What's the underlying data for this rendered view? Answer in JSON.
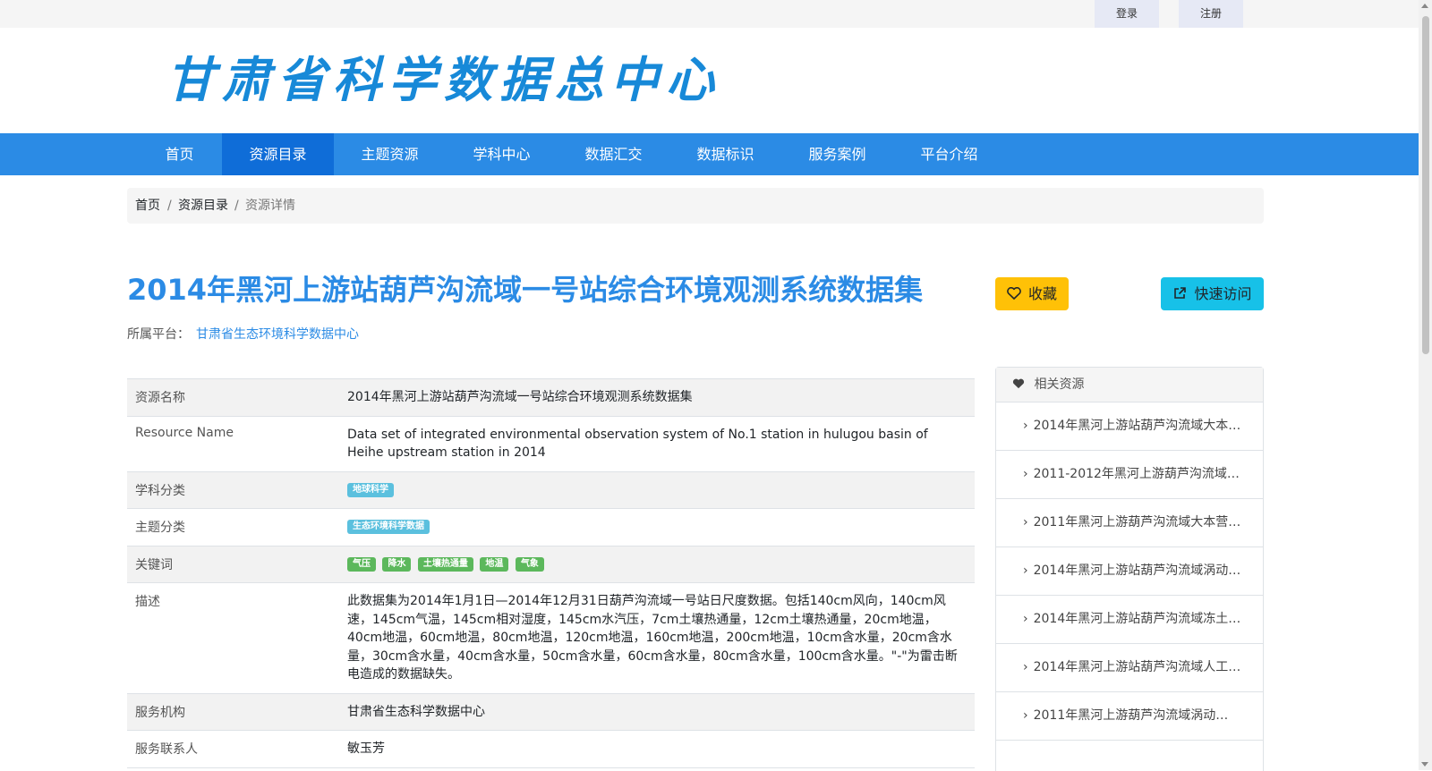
{
  "topbar": {
    "login": "登录",
    "register": "注册"
  },
  "logo": {
    "text": "甘肃省科学数据总中心"
  },
  "nav": [
    "首页",
    "资源目录",
    "主题资源",
    "学科中心",
    "数据汇交",
    "数据标识",
    "服务案例",
    "平台介绍"
  ],
  "nav_active": "资源目录",
  "breadcrumb": {
    "home": "首页",
    "sep1": "/",
    "catalog": "资源目录",
    "sep2": "/",
    "current": "资源详情"
  },
  "title": "2014年黑河上游站葫芦沟流域一号站综合环境观测系统数据集",
  "platform": {
    "label": "所属平台：",
    "value": "甘肃省生态环境科学数据中心"
  },
  "buttons": {
    "favorite": "收藏",
    "quick_visit": "快速访问"
  },
  "icons": {
    "heart": "heart-icon",
    "external": "external-link-icon",
    "chevron": "chevron-right-icon"
  },
  "colors": {
    "primary": "#2b8be5",
    "nav_active": "#0f6dd8",
    "warning": "#ffc107",
    "info": "#17c1e8",
    "badge_info": "#5bc0de",
    "badge_green": "#5cb85c"
  },
  "details": {
    "resource_name_label": "资源名称",
    "resource_name": "2014年黑河上游站葫芦沟流域一号站综合环境观测系统数据集",
    "resource_name_en_label": "Resource Name",
    "resource_name_en": "Data set of integrated environmental observation system of No.1 station in hulugou basin of Heihe upstream station in 2014",
    "subject_label": "学科分类",
    "subject_tag": "地球科学",
    "topic_label": "主题分类",
    "topic_tag": "生态环境科学数据",
    "keywords_label": "关键词",
    "keywords": [
      "气压",
      "降水",
      "土壤热通量",
      "地温",
      "气象"
    ],
    "description_label": "描述",
    "description": "此数据集为2014年1月1日—2014年12月31日葫芦沟流域一号站日尺度数据。包括140cm风向，140cm风速，145cm气温，145cm相对湿度，145cm水汽压，7cm土壤热通量，12cm土壤热通量，20cm地温，40cm地温，60cm地温，80cm地温，120cm地温，160cm地温，200cm地温，10cm含水量，20cm含水量，30cm含水量，40cm含水量，50cm含水量，60cm含水量，80cm含水量，100cm含水量。\"-\"为雷击断电造成的数据缺失。",
    "org_label": "服务机构",
    "org": "甘肃省生态科学数据中心",
    "contact_label": "服务联系人",
    "contact": "敏玉芳"
  },
  "related": {
    "title": "相关资源",
    "items": [
      "2014年黑河上游站葫芦沟流域大本…",
      "2011-2012年黑河上游葫芦沟流域…",
      "2011年黑河上游葫芦沟流域大本营…",
      "2014年黑河上游站葫芦沟流域涡动…",
      "2014年黑河上游站葫芦沟流域冻土…",
      "2014年黑河上游站葫芦沟流域人工…",
      "2011年黑河上游葫芦沟流域涡动…"
    ]
  }
}
